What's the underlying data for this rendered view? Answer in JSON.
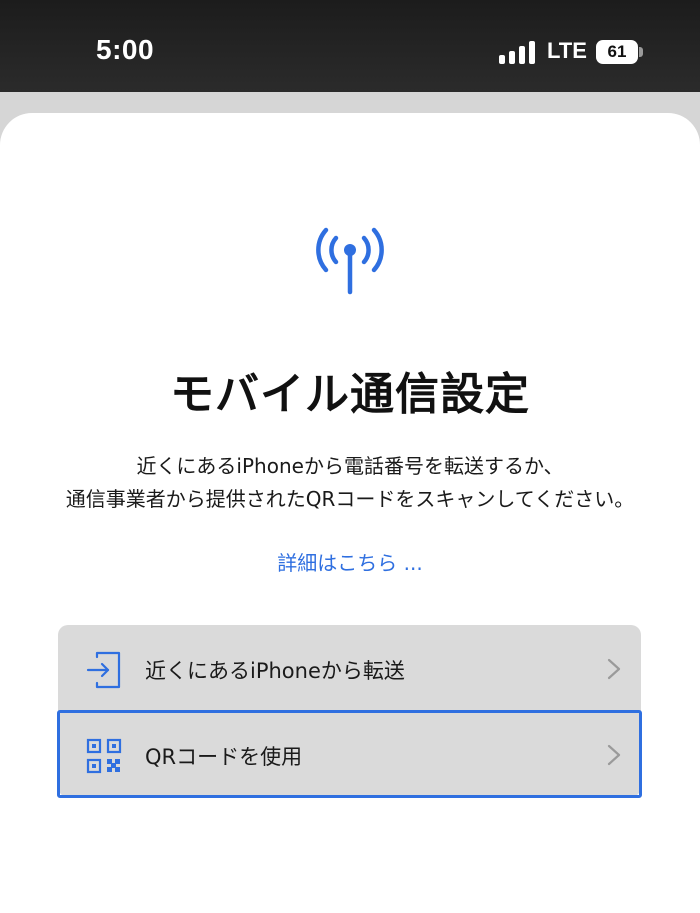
{
  "status_bar": {
    "time": "5:00",
    "network": "LTE",
    "battery": "61"
  },
  "main": {
    "title": "モバイル通信設定",
    "description_line1": "近くにあるiPhoneから電話番号を転送するか、",
    "description_line2": "通信事業者から提供されたQRコードをスキャンしてください。",
    "learn_more": "詳細はこちら ..."
  },
  "options": [
    {
      "label": "近くにあるiPhoneから転送",
      "icon": "transfer-icon"
    },
    {
      "label": "QRコードを使用",
      "icon": "qr-code-icon",
      "selected": true
    }
  ],
  "colors": {
    "accent": "#2f6fe0",
    "background": "#ffffff",
    "option_background": "#dadada"
  }
}
